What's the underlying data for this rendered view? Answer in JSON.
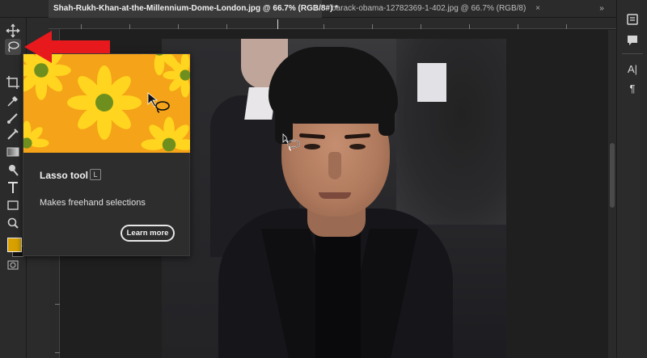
{
  "tabs": [
    {
      "label": "Shah-Rukh-Khan-at-the-Millennium-Dome-London.jpg @ 66.7% (RGB/8#) *",
      "active": true
    },
    {
      "label": "barack-obama-12782369-1-402.jpg @ 66.7% (RGB/8)",
      "active": false
    }
  ],
  "tab_close_glyph": "×",
  "collapse_glyph": "»",
  "toolbar": {
    "tools": [
      "move-tool-icon",
      "marquee-tool-icon",
      "lasso-tool-icon",
      "eyedropper-icon",
      "crop-tool-icon",
      "brush-icon",
      "healing-brush-icon",
      "gradient-icon",
      "dodge-tool-icon",
      "type-tool-icon",
      "rectangle-tool-icon",
      "zoom-tool-icon"
    ],
    "foreground_color": "#d8a100",
    "background_color": "#111111"
  },
  "tooltip": {
    "title": "Lasso tool",
    "shortcut": "L",
    "description": "Makes freehand selections",
    "button": "Learn more"
  },
  "right_panel": {
    "icons": [
      "history-icon",
      "comment-icon",
      "character-icon",
      "paragraph-icon"
    ],
    "character_glyph": "A|",
    "paragraph_glyph": "¶"
  },
  "colors": {
    "accent_arrow": "#e8191c",
    "preview_bg": "#f5a318",
    "flower": "#ffd51f"
  }
}
